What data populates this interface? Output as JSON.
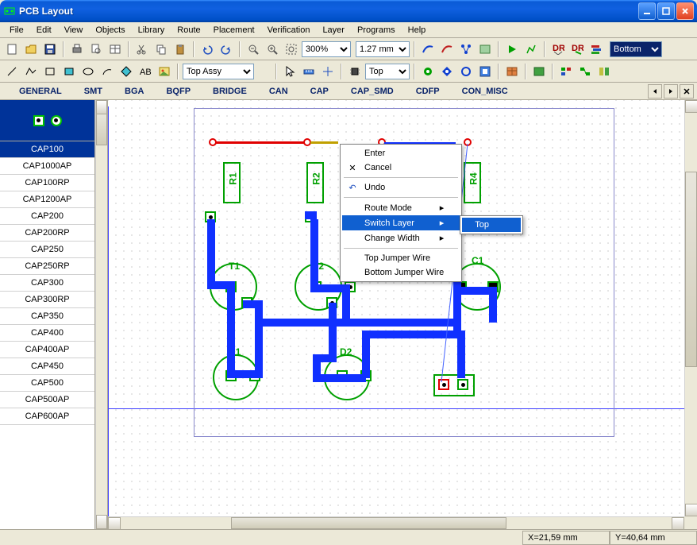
{
  "window": {
    "title": "PCB Layout"
  },
  "menu": [
    "File",
    "Edit",
    "View",
    "Objects",
    "Library",
    "Route",
    "Placement",
    "Verification",
    "Layer",
    "Programs",
    "Help"
  ],
  "toolbar1": {
    "zoom_value": "300%",
    "grid_value": "1.27 mm",
    "layer_combo": "Bottom"
  },
  "toolbar2": {
    "assy_combo": "Top Assy",
    "layer2_combo": "Top"
  },
  "tabs": [
    "GENERAL",
    "SMT",
    "BGA",
    "BQFP",
    "BRIDGE",
    "CAN",
    "CAP",
    "CAP_SMD",
    "CDFP",
    "CON_MISC"
  ],
  "partlist": {
    "selected": "CAP100",
    "items": [
      "CAP100",
      "CAP1000AP",
      "CAP100RP",
      "CAP1200AP",
      "CAP200",
      "CAP200RP",
      "CAP250",
      "CAP250RP",
      "CAP300",
      "CAP300RP",
      "CAP350",
      "CAP400",
      "CAP400AP",
      "CAP450",
      "CAP500",
      "CAP500AP",
      "CAP600AP"
    ]
  },
  "components": {
    "R1": "R1",
    "R2": "R2",
    "R4": "R4",
    "T1": "T1",
    "T2": "T2",
    "C1": "C1",
    "D1": "D1",
    "D2": "D2"
  },
  "context_menu": {
    "enter": "Enter",
    "cancel": "Cancel",
    "undo": "Undo",
    "route_mode": "Route Mode",
    "switch_layer": "Switch Layer",
    "change_width": "Change Width",
    "top_jumper": "Top Jumper Wire",
    "bottom_jumper": "Bottom Jumper Wire",
    "submenu_top": "Top"
  },
  "status": {
    "x": "X=21,59 mm",
    "y": "Y=40,64 mm"
  }
}
